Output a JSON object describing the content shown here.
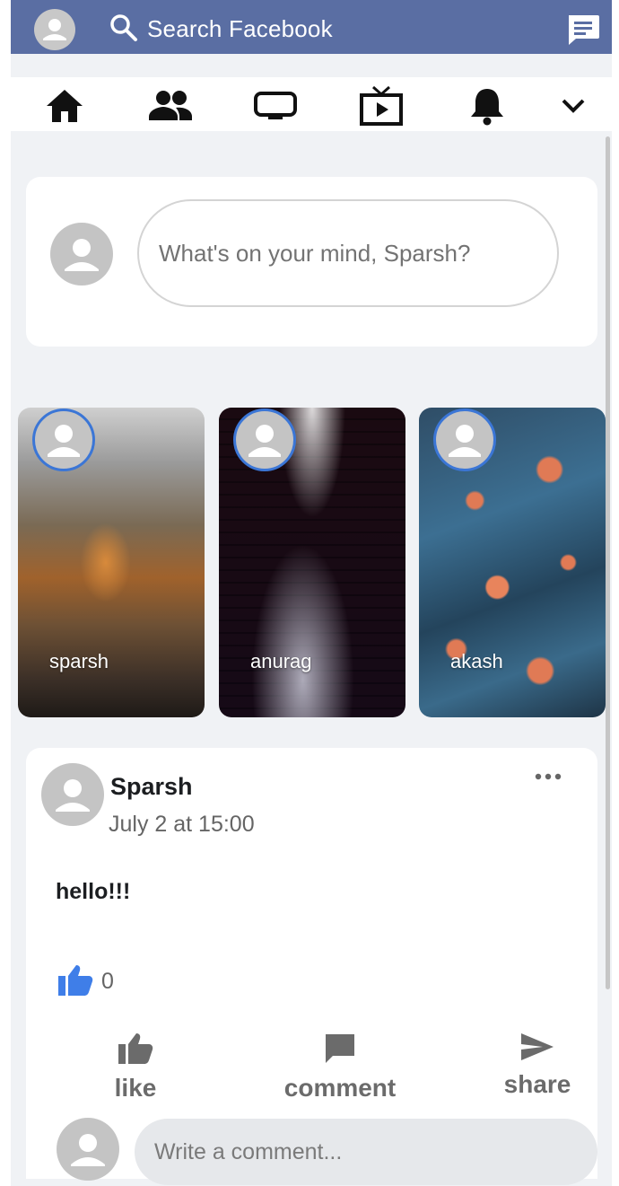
{
  "topbar": {
    "search_label": "Search Facebook",
    "icons": [
      "avatar-icon",
      "search-icon",
      "messenger-icon"
    ]
  },
  "navbar": {
    "items": [
      {
        "name": "home",
        "icon": "home-icon"
      },
      {
        "name": "friends",
        "icon": "friends-icon"
      },
      {
        "name": "watch-screen",
        "icon": "screen-icon"
      },
      {
        "name": "live-tv",
        "icon": "tv-icon"
      },
      {
        "name": "notifications",
        "icon": "bell-icon"
      },
      {
        "name": "menu",
        "icon": "chevron-down-icon"
      }
    ]
  },
  "composer": {
    "placeholder": "What's on your mind, Sparsh?"
  },
  "stories": [
    {
      "name": "sparsh"
    },
    {
      "name": "anurag"
    },
    {
      "name": "akash"
    }
  ],
  "post": {
    "author": "Sparsh",
    "time": "July 2 at 15:00",
    "text": "hello!!!",
    "like_count": "0",
    "actions": {
      "like": "like",
      "comment": "comment",
      "share": "share"
    },
    "comment_placeholder": "Write a comment..."
  },
  "colors": {
    "topbar": "#5a6ea3",
    "background": "#f0f2f5",
    "accent": "#3b76d6",
    "like_blue": "#3f7ee8"
  }
}
